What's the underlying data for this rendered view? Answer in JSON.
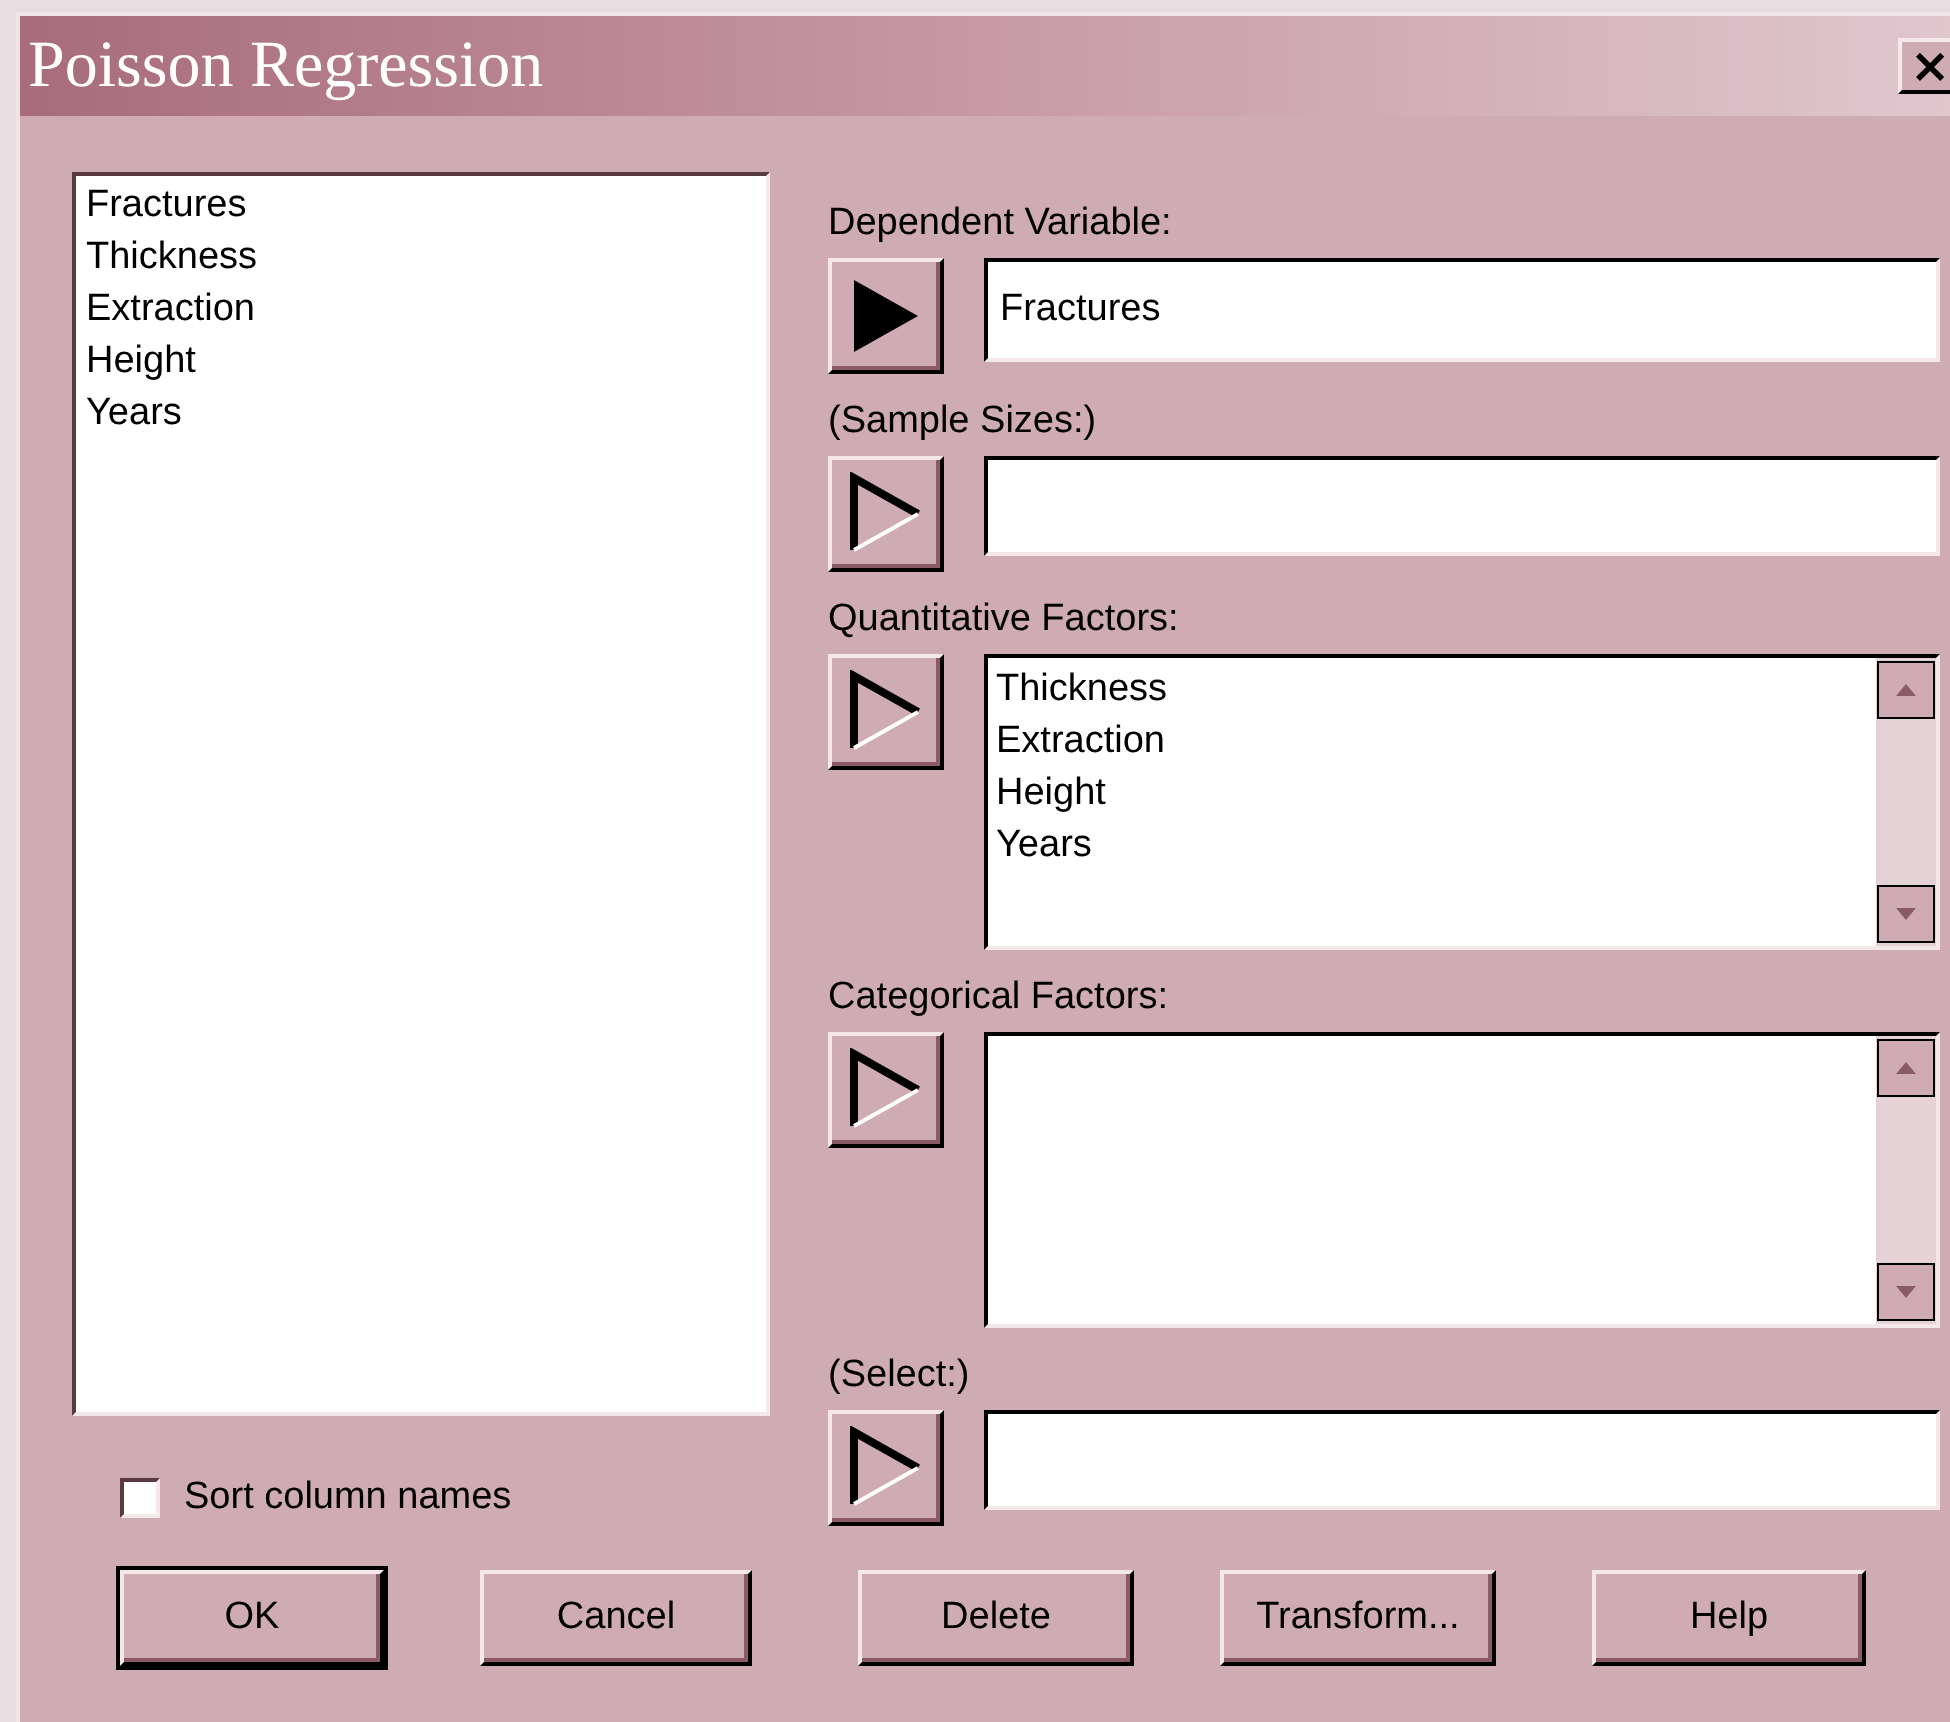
{
  "window": {
    "title": "Poisson Regression",
    "close": "×"
  },
  "columns_list": {
    "items": [
      "Fractures",
      "Thickness",
      "Extraction",
      "Height",
      "Years"
    ]
  },
  "sort_column_names": {
    "label": "Sort column names",
    "checked": false
  },
  "inputs": [
    {
      "label": "Dependent Variable:",
      "kind": "field",
      "arrow_active": true,
      "values": [
        "Fractures"
      ]
    },
    {
      "label": "(Sample Sizes:)",
      "kind": "field",
      "arrow_active": false
    },
    {
      "label": "Quantitative Factors:",
      "kind": "list",
      "arrow_active": false,
      "values": [
        "Thickness",
        "Extraction",
        "Height",
        "Years"
      ]
    },
    {
      "label": "Categorical Factors:",
      "kind": "list",
      "arrow_active": false
    },
    {
      "label": "(Select:)",
      "kind": "field",
      "arrow_active": false
    }
  ],
  "buttons": [
    {
      "label": "OK",
      "default": true
    },
    {
      "label": "Cancel",
      "default": false
    },
    {
      "label": "Delete",
      "default": false
    },
    {
      "label": "Transform...",
      "default": false
    },
    {
      "label": "Help",
      "default": false
    }
  ]
}
